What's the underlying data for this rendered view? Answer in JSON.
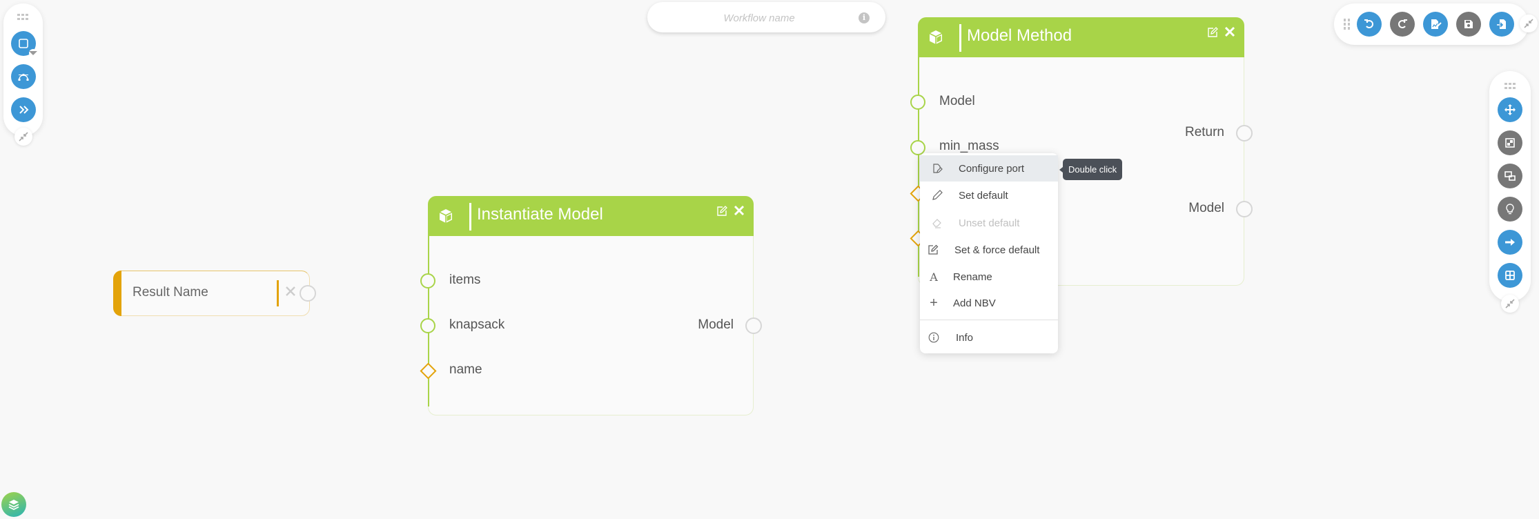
{
  "colors": {
    "accent_blue": "#3d97d6",
    "gray_button": "#777777",
    "node_header_green": "#a8d448",
    "optional_port_orange": "#e3a30a",
    "canvas_bg": "#f8f8f8"
  },
  "left_toolbar": {
    "grip_icon": "grip-dots-icon",
    "buttons": [
      {
        "name": "add-block",
        "icon": "square-icon",
        "has_dropdown": true
      },
      {
        "name": "add-connection",
        "icon": "bezier-curve-icon"
      },
      {
        "name": "expand-panel",
        "icon": "double-chevron-right-icon"
      }
    ],
    "collapse_icon": "compress-icon"
  },
  "workflow_name": {
    "value": "",
    "placeholder": "Workflow name",
    "info_icon": "info-icon"
  },
  "top_right_toolbar": {
    "grip_icon": "grip-dots-icon",
    "buttons": [
      {
        "name": "undo",
        "icon": "undo-icon",
        "state": "enabled"
      },
      {
        "name": "redo",
        "icon": "redo-icon",
        "state": "disabled"
      },
      {
        "name": "edit-workflow",
        "icon": "file-signature-icon",
        "state": "enabled"
      },
      {
        "name": "save",
        "icon": "save-icon",
        "state": "disabled"
      },
      {
        "name": "import",
        "icon": "file-import-icon",
        "state": "enabled"
      }
    ],
    "collapse_icon": "compress-icon"
  },
  "right_toolbar": {
    "grip_icon": "grip-dots-icon",
    "buttons": [
      {
        "name": "move",
        "icon": "arrows-move-icon",
        "state": "enabled"
      },
      {
        "name": "fit-view",
        "icon": "fit-frame-icon",
        "state": "disabled"
      },
      {
        "name": "reorder",
        "icon": "swap-frames-icon",
        "state": "disabled"
      },
      {
        "name": "tips",
        "icon": "lightbulb-icon",
        "state": "disabled"
      },
      {
        "name": "run",
        "icon": "arrow-right-icon",
        "state": "enabled"
      },
      {
        "name": "grid",
        "icon": "grid-icon",
        "state": "enabled"
      }
    ],
    "collapse_icon": "compress-icon"
  },
  "nodes": {
    "result_name": {
      "label": "Result Name"
    },
    "instantiate_model": {
      "title": "Instantiate Model",
      "inputs": [
        {
          "label": "items",
          "kind": "required"
        },
        {
          "label": "knapsack",
          "kind": "required"
        },
        {
          "label": "name",
          "kind": "optional"
        }
      ],
      "outputs": [
        {
          "label": "Model"
        }
      ]
    },
    "model_method": {
      "title": "Model Method",
      "inputs": [
        {
          "label": "Model",
          "kind": "required"
        },
        {
          "label": "min_mass",
          "kind": "required"
        },
        {
          "label": "",
          "kind": "optional"
        },
        {
          "label": "",
          "kind": "optional"
        }
      ],
      "outputs": [
        {
          "label": "Return"
        },
        {
          "label": "Model"
        }
      ]
    }
  },
  "context_menu": {
    "items": [
      {
        "label": "Configure port",
        "icon": "file-pen-icon",
        "highlighted": true,
        "disabled": false
      },
      {
        "label": "Set default",
        "icon": "pencil-icon",
        "highlighted": false,
        "disabled": false
      },
      {
        "label": "Unset default",
        "icon": "eraser-icon",
        "highlighted": false,
        "disabled": true
      },
      {
        "label": "Set & force default",
        "icon": "edit-square-icon",
        "highlighted": false,
        "disabled": false
      },
      {
        "label": "Rename",
        "icon": "letter-a-icon",
        "highlighted": false,
        "disabled": false
      },
      {
        "label": "Add NBV",
        "icon": "plus-icon",
        "highlighted": false,
        "disabled": false
      },
      {
        "label": "Info",
        "icon": "info-circle-icon",
        "highlighted": false,
        "disabled": false
      }
    ],
    "tooltip": "Double click"
  },
  "layers_button": {
    "icon": "layers-icon"
  }
}
